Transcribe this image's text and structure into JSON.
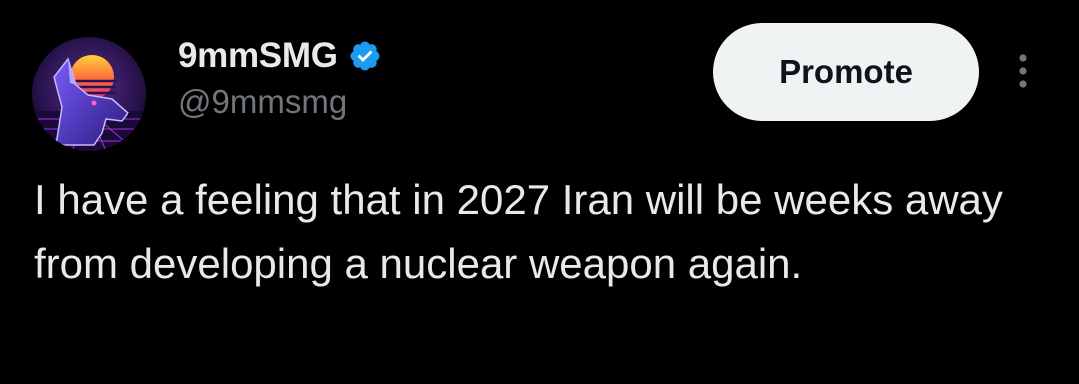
{
  "tweet": {
    "author": {
      "display_name": "9mmSMG",
      "handle": "@9mmsmg",
      "verified": true,
      "avatar_icon": "synthwave-dog-avatar"
    },
    "promote_label": "Promote",
    "more_icon": "more-vertical-icon",
    "text": "I have a feeling that in 2027 Iran will be weeks away from developing a nuclear weapon again."
  },
  "colors": {
    "background": "#000000",
    "text": "#e7e9ea",
    "muted": "#71767b",
    "verified": "#1d9bf0",
    "button_bg": "#eff3f4"
  }
}
